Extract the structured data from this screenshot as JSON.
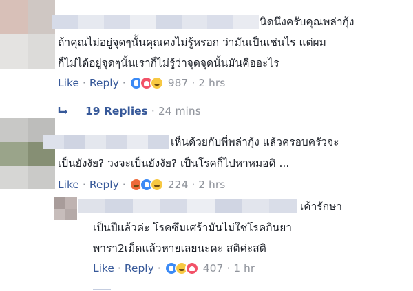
{
  "comments": [
    {
      "text_lines": [
        "นิดนึงครับคุณพล่ากุ้ง",
        "ถ้าคุณไม่อยู่จุดๆนั้นคุณคงไม่รู้หรอก ว่ามันเป็นเช่นไร แต่ผม",
        "ก็ไม่ได้อยู่จุดๆนั้นเราก็ไม่รู้ว่าจุดจุดนั้นมันคืออะไร"
      ],
      "like_label": "Like",
      "reply_label": "Reply",
      "reactions": [
        "like",
        "love",
        "sad"
      ],
      "reaction_count": "987",
      "time": "2 hrs"
    },
    {
      "text_lines": [
        "เห็นด้วยกับพี่พล่ากุ้ง แล้วครอบครัวจะ",
        "เป็นยังงัย? วงจะเป็นยังงัย? เป็นโรคก็ไปหาหมอดิ ..."
      ],
      "like_label": "Like",
      "reply_label": "Reply",
      "reactions": [
        "angry",
        "like",
        "haha"
      ],
      "reaction_count": "224",
      "time": "2 hrs"
    },
    {
      "text_lines": [
        "เค้ารักษา",
        "เป็นปีแล้วค่ะ โรคซึมเศร้ามันไม่ใช่โรคกินยา",
        "พารา2เม็ดแล้วหายเลยนะคะ สติค่ะสติ"
      ],
      "like_label": "Like",
      "reply_label": "Reply",
      "reactions": [
        "like",
        "sad",
        "love"
      ],
      "reaction_count": "407",
      "time": "1 hr"
    }
  ],
  "replies_link": {
    "label": "19 Replies",
    "time": "24 mins"
  },
  "colors": {
    "link": "#365899",
    "meta": "#90949c",
    "text": "#1d2129"
  },
  "icons": {
    "reply_arrow": "reply-arrow-icon"
  }
}
